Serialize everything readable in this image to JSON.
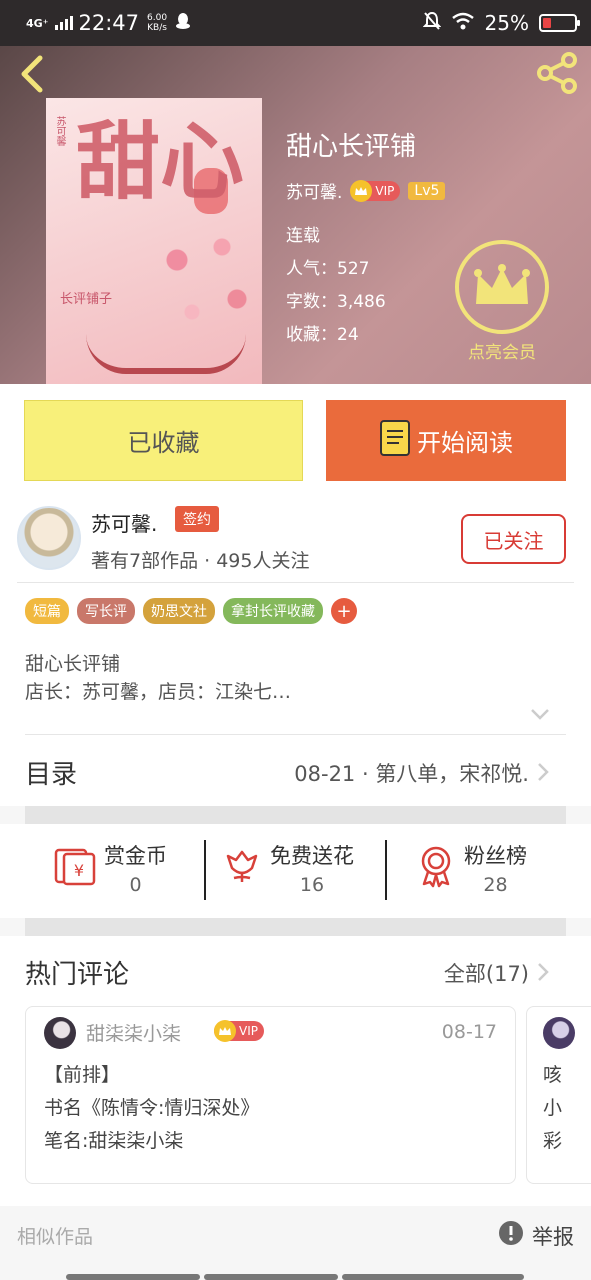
{
  "status_bar": {
    "network": "4G⁺",
    "time": "22:47",
    "speed_value": "6.00",
    "speed_unit": "KB/s",
    "battery": "25%",
    "battery_level": 0.25,
    "battery_color": "#e94545"
  },
  "book": {
    "title": "甜心长评铺",
    "author": "苏可馨.",
    "vip_label": "VIP",
    "level": "Lv5",
    "status": "连载",
    "popularity": "人气：527",
    "word_count": "字数：3,486",
    "favorites": "收藏：24",
    "member_label": "点亮会员",
    "cover_title": "甜心",
    "cover_subtitle": "长评铺子",
    "cover_vertical": "苏可馨"
  },
  "actions": {
    "favorited_label": "已收藏",
    "read_label": "开始阅读"
  },
  "author_card": {
    "name": "苏可馨.",
    "sign_tag": "签约",
    "stats": "著有7部作品 · 495人关注",
    "follow_label": "已关注"
  },
  "tags": [
    {
      "label": "短篇",
      "color": "#f1b93f"
    },
    {
      "label": "写长评",
      "color": "#c9786a"
    },
    {
      "label": "奶思文社",
      "color": "#d4a23c"
    },
    {
      "label": "拿封长评收藏",
      "color": "#84b85b"
    }
  ],
  "tag_add": "+",
  "intro": {
    "line1": "甜心长评铺",
    "line2": "店长：苏可馨，店员：江染七…"
  },
  "catalog": {
    "label": "目录",
    "latest": "08-21 · 第八单，宋祁悦."
  },
  "rewards": [
    {
      "label": "赏金币",
      "value": "0"
    },
    {
      "label": "免费送花",
      "value": "16"
    },
    {
      "label": "粉丝榜",
      "value": "28"
    }
  ],
  "comments": {
    "label": "热门评论",
    "all": "全部(17)",
    "card": {
      "user": "甜柒柒小柒",
      "vip": "VIP",
      "date": "08-17",
      "lines": [
        "【前排】",
        "书名《陈情令:情归深处》",
        "笔名:甜柒柒小柒"
      ]
    },
    "card2_peek": [
      "咳",
      "小",
      "彩"
    ]
  },
  "footer": {
    "similar": "相似作品",
    "report": "举报"
  },
  "colors": {
    "accent_orange": "#ea6b3c",
    "favorited_yellow": "#f8f07a",
    "follow_red": "#d83b35",
    "member_gold": "#f2e47a"
  }
}
